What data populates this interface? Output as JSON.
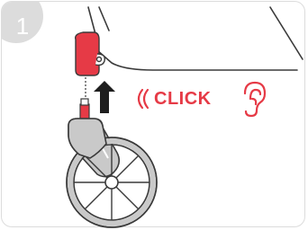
{
  "step": {
    "number": "1"
  },
  "callout": {
    "click_text": "CLICK"
  },
  "colors": {
    "accent": "#e63a46",
    "badge": "#dcdcdc",
    "outline": "#3a3a3a",
    "wheel_fill": "#c9c9c9",
    "arrow": "#1e1e1e"
  },
  "icons": [
    "sound-waves-icon",
    "ear-icon",
    "up-arrow-icon"
  ]
}
